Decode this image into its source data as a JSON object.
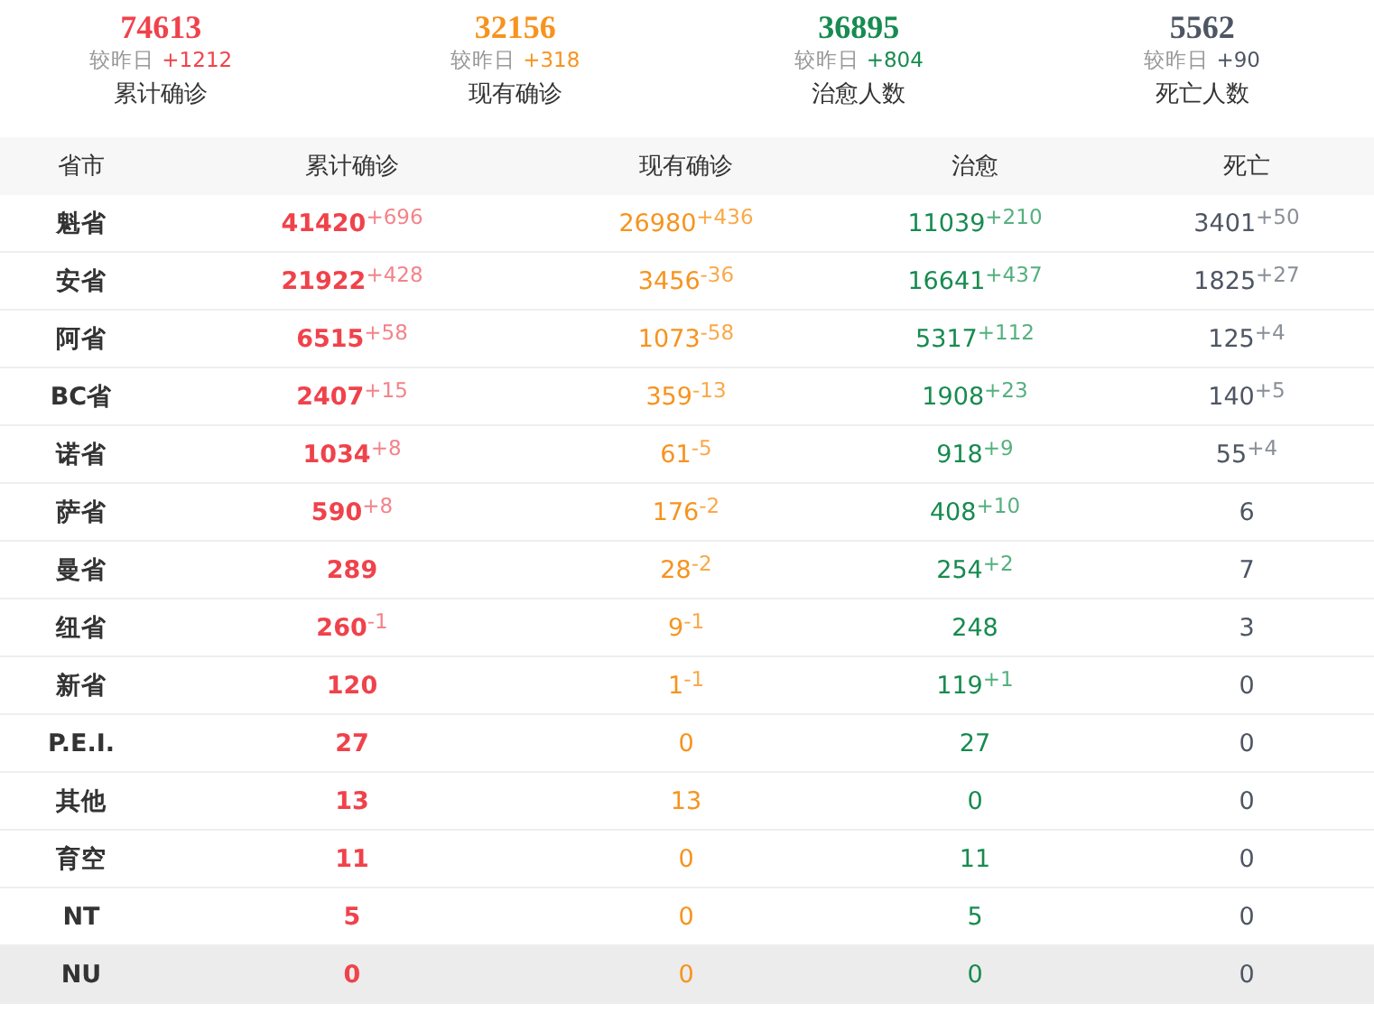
{
  "summary": [
    {
      "kind": "confirmed",
      "value": "74613",
      "compare_label": "较昨日",
      "change": "+1212",
      "label": "累计确诊"
    },
    {
      "kind": "active",
      "value": "32156",
      "compare_label": "较昨日",
      "change": "+318",
      "label": "现有确诊"
    },
    {
      "kind": "recovered",
      "value": "36895",
      "compare_label": "较昨日",
      "change": "+804",
      "label": "治愈人数"
    },
    {
      "kind": "deaths",
      "value": "5562",
      "compare_label": "较昨日",
      "change": "+90",
      "label": "死亡人数"
    }
  ],
  "table": {
    "columns": [
      {
        "kind": "region",
        "label": "省市"
      },
      {
        "kind": "confirmed",
        "label": "累计确诊"
      },
      {
        "kind": "active",
        "label": "现有确诊"
      },
      {
        "kind": "recovered",
        "label": "治愈"
      },
      {
        "kind": "deaths",
        "label": "死亡"
      }
    ],
    "rows": [
      {
        "selected": false,
        "cells": [
          {
            "value": "魁省"
          },
          {
            "value": "41420",
            "change": "+696"
          },
          {
            "value": "26980",
            "change": "+436"
          },
          {
            "value": "11039",
            "change": "+210"
          },
          {
            "value": "3401",
            "change": "+50"
          }
        ]
      },
      {
        "selected": false,
        "cells": [
          {
            "value": "安省"
          },
          {
            "value": "21922",
            "change": "+428"
          },
          {
            "value": "3456",
            "change": "-36"
          },
          {
            "value": "16641",
            "change": "+437"
          },
          {
            "value": "1825",
            "change": "+27"
          }
        ]
      },
      {
        "selected": false,
        "cells": [
          {
            "value": "阿省"
          },
          {
            "value": "6515",
            "change": "+58"
          },
          {
            "value": "1073",
            "change": "-58"
          },
          {
            "value": "5317",
            "change": "+112"
          },
          {
            "value": "125",
            "change": "+4"
          }
        ]
      },
      {
        "selected": false,
        "cells": [
          {
            "value": "BC省"
          },
          {
            "value": "2407",
            "change": "+15"
          },
          {
            "value": "359",
            "change": "-13"
          },
          {
            "value": "1908",
            "change": "+23"
          },
          {
            "value": "140",
            "change": "+5"
          }
        ]
      },
      {
        "selected": false,
        "cells": [
          {
            "value": "诺省"
          },
          {
            "value": "1034",
            "change": "+8"
          },
          {
            "value": "61",
            "change": "-5"
          },
          {
            "value": "918",
            "change": "+9"
          },
          {
            "value": "55",
            "change": "+4"
          }
        ]
      },
      {
        "selected": false,
        "cells": [
          {
            "value": "萨省"
          },
          {
            "value": "590",
            "change": "+8"
          },
          {
            "value": "176",
            "change": "-2"
          },
          {
            "value": "408",
            "change": "+10"
          },
          {
            "value": "6"
          }
        ]
      },
      {
        "selected": false,
        "cells": [
          {
            "value": "曼省"
          },
          {
            "value": "289"
          },
          {
            "value": "28",
            "change": "-2"
          },
          {
            "value": "254",
            "change": "+2"
          },
          {
            "value": "7"
          }
        ]
      },
      {
        "selected": false,
        "cells": [
          {
            "value": "纽省"
          },
          {
            "value": "260",
            "change": "-1"
          },
          {
            "value": "9",
            "change": "-1"
          },
          {
            "value": "248"
          },
          {
            "value": "3"
          }
        ]
      },
      {
        "selected": false,
        "cells": [
          {
            "value": "新省"
          },
          {
            "value": "120"
          },
          {
            "value": "1",
            "change": "-1"
          },
          {
            "value": "119",
            "change": "+1"
          },
          {
            "value": "0"
          }
        ]
      },
      {
        "selected": false,
        "cells": [
          {
            "value": "P.E.I."
          },
          {
            "value": "27"
          },
          {
            "value": "0"
          },
          {
            "value": "27"
          },
          {
            "value": "0"
          }
        ]
      },
      {
        "selected": false,
        "cells": [
          {
            "value": "其他"
          },
          {
            "value": "13"
          },
          {
            "value": "13"
          },
          {
            "value": "0"
          },
          {
            "value": "0"
          }
        ]
      },
      {
        "selected": false,
        "cells": [
          {
            "value": "育空"
          },
          {
            "value": "11"
          },
          {
            "value": "0"
          },
          {
            "value": "11"
          },
          {
            "value": "0"
          }
        ]
      },
      {
        "selected": false,
        "cells": [
          {
            "value": "NT"
          },
          {
            "value": "5"
          },
          {
            "value": "0"
          },
          {
            "value": "5"
          },
          {
            "value": "0"
          }
        ]
      },
      {
        "selected": true,
        "cells": [
          {
            "value": "NU"
          },
          {
            "value": "0"
          },
          {
            "value": "0"
          },
          {
            "value": "0"
          },
          {
            "value": "0"
          }
        ]
      }
    ]
  }
}
